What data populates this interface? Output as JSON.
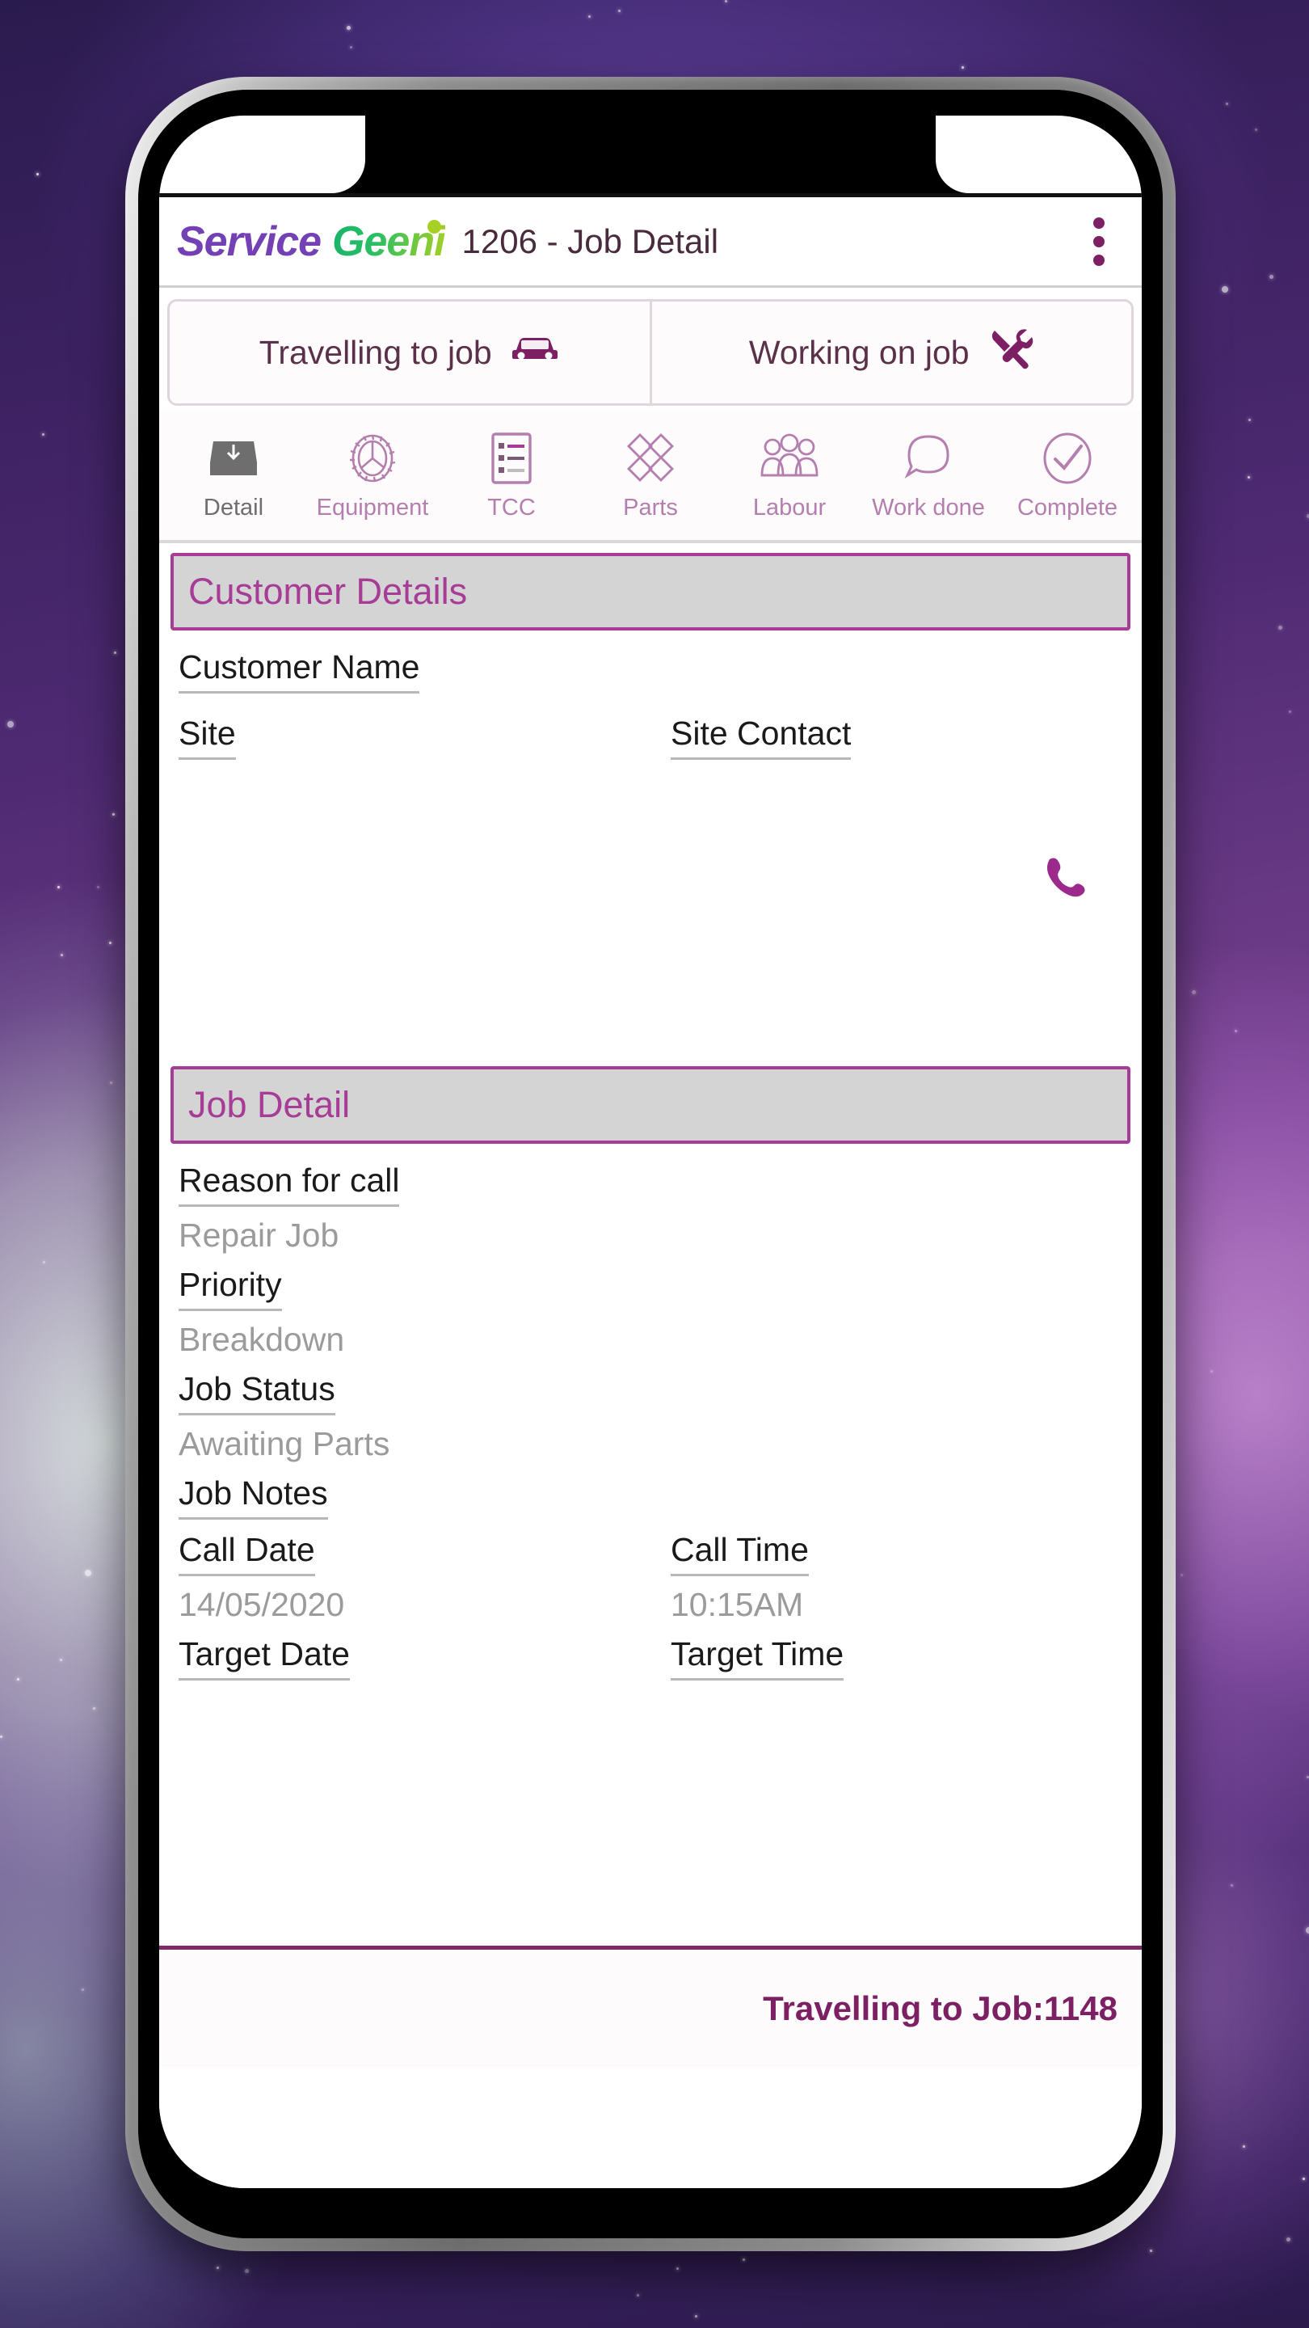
{
  "header": {
    "logo_service": "Service",
    "logo_geeni": "Geeni",
    "title": "1206 - Job Detail",
    "overflow_icon": "more-vertical-icon"
  },
  "status_buttons": [
    {
      "label": "Travelling to job",
      "icon": "car-icon"
    },
    {
      "label": "Working on job",
      "icon": "tools-icon"
    }
  ],
  "tabs": [
    {
      "label": "Detail",
      "icon": "inbox-tray-icon",
      "active": true
    },
    {
      "label": "Equipment",
      "icon": "gear-icon",
      "active": false
    },
    {
      "label": "TCC",
      "icon": "checklist-icon",
      "active": false
    },
    {
      "label": "Parts",
      "icon": "diamonds-icon",
      "active": false
    },
    {
      "label": "Labour",
      "icon": "people-icon",
      "active": false
    },
    {
      "label": "Work done",
      "icon": "speech-bubble-icon",
      "active": false
    },
    {
      "label": "Complete",
      "icon": "check-circle-icon",
      "active": false
    }
  ],
  "customer_section": {
    "heading": "Customer Details",
    "customer_name_label": "Customer Name",
    "customer_name_value": "",
    "site_label": "Site",
    "site_value": "",
    "site_contact_label": "Site Contact",
    "site_contact_value": "",
    "phone_icon": "phone-handset-icon"
  },
  "job_section": {
    "heading": "Job Detail",
    "reason_label": "Reason for call",
    "reason_value": "Repair Job",
    "priority_label": "Priority",
    "priority_value": "Breakdown",
    "status_label": "Job Status",
    "status_value": "Awaiting Parts",
    "notes_label": "Job Notes",
    "notes_value": "",
    "call_date_label": "Call Date",
    "call_date_value": "14/05/2020",
    "call_time_label": "Call Time",
    "call_time_value": "10:15AM",
    "target_date_label": "Target Date",
    "target_time_label": "Target Time"
  },
  "footer": {
    "status_text": "Travelling to Job:1148"
  },
  "colors": {
    "brand_purple": "#7341b5",
    "brand_green": "#2bbf63",
    "accent_magenta": "#a63c96",
    "footer_purple": "#7c1f63",
    "label_gray": "#9b9b9b"
  }
}
